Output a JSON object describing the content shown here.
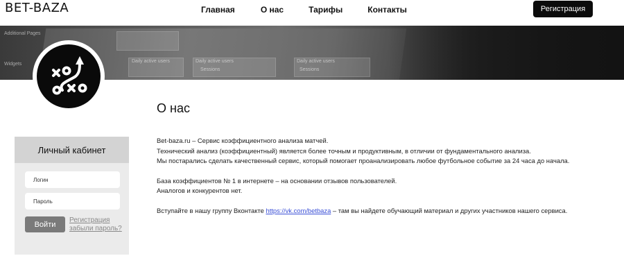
{
  "header": {
    "logo": "BET-BAZA",
    "nav": [
      "Главная",
      "О нас",
      "Тарифы",
      "Контакты"
    ],
    "register_button": "Регистрация"
  },
  "login": {
    "title": "Личный кабинет",
    "login_placeholder": "Логин",
    "password_placeholder": "Пароль",
    "submit": "Войти",
    "register_link": "Регистрация",
    "forgot_link": "забыли пароль?"
  },
  "about": {
    "title": "О нас",
    "line1": "Bet-baza.ru – Сервис коэффициентного анализа матчей.",
    "line2": "Технический анализ (коэффициентный) является более точным и продуктивным, в отличии от фундаментального анализа.",
    "line3": "Мы постарались сделать качественный сервис, который помогает проанализировать любое футбольное событие за 24 часа до начала.",
    "line4": "База коэффициентов № 1 в интернете – на основании отзывов пользователей.",
    "line5": "Аналогов и конкурентов нет.",
    "line6_pre": "Вступайте в нашу группу Вконтакте ",
    "line6_link": "https://vk.com/betbaza",
    "line6_post": " – там вы найдете обучающий материал и других участников нашего сервиса."
  },
  "banner_texts": [
    "Daily active users",
    "Daily active users",
    "Daily active users",
    "Sessions",
    "Sessions",
    "Widgets",
    "Additional Pages"
  ],
  "colors": {
    "header_bg": "#ffffff",
    "button_dark": "#0b0b0b",
    "card_bg": "#ebebeb",
    "card_head": "#d3d3d3",
    "submit_bg": "#7a7a7a",
    "link": "#3a4fd6"
  },
  "icons": {
    "avatar": "tactics-xo-arrow-icon"
  }
}
